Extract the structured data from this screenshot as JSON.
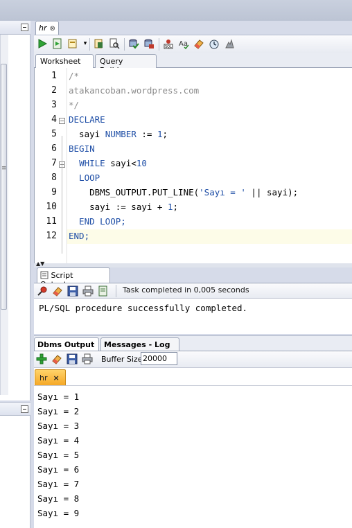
{
  "editor_tab": {
    "label": "hr",
    "close": "⊗"
  },
  "toolbar_icons": [
    "run-statement",
    "run-script",
    "commit",
    "rollback",
    "explain-plan",
    "autotrace",
    "sql-tuning",
    "format",
    "clear",
    "history",
    "sql-monitor"
  ],
  "sub_tabs": {
    "worksheet": "Worksheet",
    "query_builder": "Query Builder"
  },
  "code": {
    "line_numbers": [
      "1",
      "2",
      "3",
      "4",
      "5",
      "6",
      "7",
      "8",
      "9",
      "10",
      "11",
      "12"
    ],
    "lines": [
      {
        "t": "/*",
        "c": "cm"
      },
      {
        "t": "atakancoban.wordpress.com",
        "c": "cm"
      },
      {
        "t": "*/",
        "c": "cm"
      },
      {
        "t": "DECLARE",
        "c": "kw"
      },
      {
        "t": "  sayi NUMBER := 1;",
        "c": "mixed"
      },
      {
        "t": "BEGIN",
        "c": "kw"
      },
      {
        "t": "  WHILE sayi<10",
        "c": "mixed"
      },
      {
        "t": "  LOOP",
        "c": "kw"
      },
      {
        "t": "    DBMS_OUTPUT.PUT_LINE('Sayı = ' || sayi);",
        "c": "mixed"
      },
      {
        "t": "    sayi := sayi + 1;",
        "c": "mixed"
      },
      {
        "t": "  END LOOP;",
        "c": "kw"
      },
      {
        "t": "END;",
        "c": "kw"
      }
    ]
  },
  "script_output": {
    "tab_label": "Script Output",
    "close": "×",
    "status": "Task completed in 0,005 seconds",
    "result": "PL/SQL procedure successfully completed."
  },
  "dbms": {
    "tab_label": "Dbms Output",
    "tab_close": "⊗",
    "messages_tab": "Messages - Log",
    "buffer_label": "Buffer Size:",
    "buffer_value": "20000",
    "connection_tab": "hr",
    "connection_close": "×",
    "lines": [
      "Sayı = 1",
      "Sayı = 2",
      "Sayı = 3",
      "Sayı = 4",
      "Sayı = 5",
      "Sayı = 6",
      "Sayı = 7",
      "Sayı = 8",
      "Sayı = 9"
    ]
  }
}
